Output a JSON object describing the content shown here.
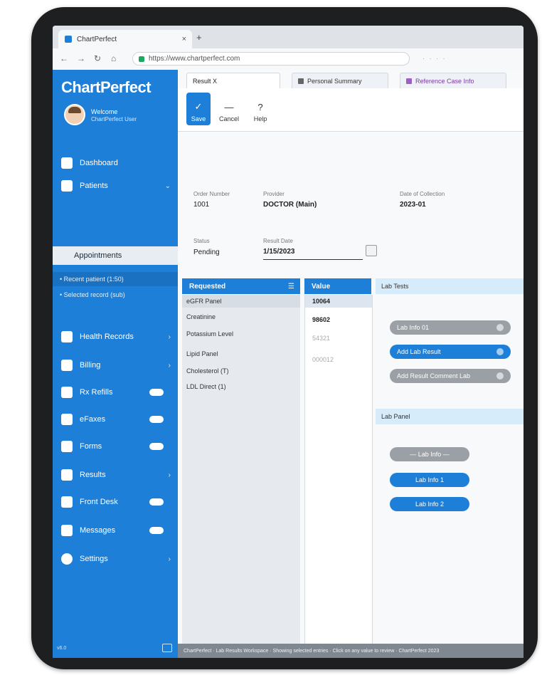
{
  "browser": {
    "tab_title": "ChartPerfect",
    "tab_close": "×",
    "new_tab": "+",
    "url": "https://www.chartperfect.com",
    "url_extras": "· · · ·"
  },
  "sidebar": {
    "logo": "ChartPerfect",
    "logo_tagline": "",
    "user_name": "Welcome",
    "user_role": "ChartPerfect User",
    "items": [
      {
        "label": "Dashboard",
        "icon": "home-icon"
      },
      {
        "label": "Patients",
        "icon": "person-icon"
      },
      {
        "label": "Appointments",
        "icon": ""
      },
      {
        "label": "Health Records",
        "icon": "folder-icon"
      },
      {
        "label": "Billing",
        "icon": "invoice-icon"
      },
      {
        "label": "Rx Refills",
        "icon": "prescription-icon"
      },
      {
        "label": "eFaxes",
        "icon": "fax-icon"
      },
      {
        "label": "Forms",
        "icon": "form-icon"
      },
      {
        "label": "Results",
        "icon": "flask-icon"
      },
      {
        "label": "Front Desk",
        "icon": "desk-icon"
      },
      {
        "label": "Messages",
        "icon": "chat-icon"
      },
      {
        "label": "Settings",
        "icon": "gear-icon"
      }
    ],
    "recent_1": "• Recent patient (1:50)",
    "recent_2": "• Selected record (sub)",
    "footer": "v6.0"
  },
  "content": {
    "tabs": [
      {
        "label": "Result X"
      },
      {
        "label": "Personal Summary"
      },
      {
        "label": "Reference Case Info"
      }
    ],
    "toolbar": {
      "save": "Save",
      "cancel": "Cancel",
      "help": "Help"
    },
    "fields": {
      "order_number_label": "Order Number",
      "order_number_value": "1001",
      "provider_label": "Provider",
      "provider_value": "DOCTOR (Main)",
      "date_label": "Date of Collection",
      "date_value": "2023-01",
      "status_label": "Status",
      "status_value": "Pending",
      "result_date_label": "Result Date",
      "result_date_value": "1/15/2023"
    },
    "list_header": "Requested",
    "value_header": "Value",
    "list_rows": [
      "eGFR Panel",
      "Creatinine",
      "Potassium Level",
      "Lipid Panel",
      "Cholesterol (T)",
      "LDL Direct (1)"
    ],
    "value_rows": [
      "10064",
      "98602",
      "54321",
      "000012"
    ],
    "lab_tests_label": "Lab Tests",
    "lab_test_pills": [
      {
        "label": "Lab Info 01",
        "style": "gray"
      },
      {
        "label": "Add Lab Result",
        "style": "blue"
      },
      {
        "label": "Add Result Comment Lab",
        "style": "gray"
      }
    ],
    "lab_panel_label": "Lab Panel",
    "lab_panel_pills": [
      {
        "label": "— Lab Info —",
        "style": "gray"
      },
      {
        "label": "Lab Info 1",
        "style": "blue"
      },
      {
        "label": "Lab Info 2",
        "style": "blue"
      }
    ],
    "statusbar": "ChartPerfect · Lab Results Workspace · Showing selected entries · Click on any value to review · ChartPerfect 2023"
  },
  "colors": {
    "accent": "#1e7fd8",
    "pill_gray": "#9aa0a6",
    "section": "#d7ecfa"
  }
}
